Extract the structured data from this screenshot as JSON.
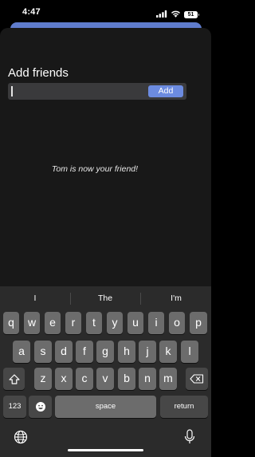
{
  "status_bar": {
    "time": "4:47",
    "battery_level": "51",
    "signal_icon": "cellular-signal-icon",
    "wifi_icon": "wifi-icon"
  },
  "sheet": {
    "title": "Add friends",
    "input_value": "",
    "input_placeholder": "",
    "add_label": "Add",
    "message": "Tom is now your friend!",
    "accent_color": "#6c8be0"
  },
  "keyboard": {
    "suggestions": [
      "I",
      "The",
      "I'm"
    ],
    "row1": [
      "q",
      "w",
      "e",
      "r",
      "t",
      "y",
      "u",
      "i",
      "o",
      "p"
    ],
    "row2": [
      "a",
      "s",
      "d",
      "f",
      "g",
      "h",
      "j",
      "k",
      "l"
    ],
    "row3": [
      "z",
      "x",
      "c",
      "v",
      "b",
      "n",
      "m"
    ],
    "numbers_label": "123",
    "space_label": "space",
    "return_label": "return",
    "shift_icon": "shift-icon",
    "backspace_icon": "backspace-icon",
    "emoji_icon": "emoji-icon",
    "globe_icon": "globe-icon",
    "mic_icon": "microphone-icon"
  }
}
